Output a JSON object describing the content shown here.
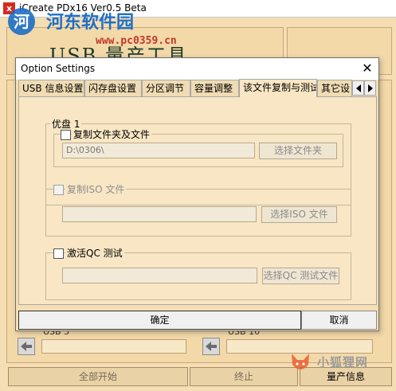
{
  "window": {
    "title": "iCreate PDx16 Ver0.5 Beta",
    "icon_letter": "x"
  },
  "watermark": {
    "logo_char": "河",
    "site_name": "河东软件园",
    "url": "www.pc0359.cn"
  },
  "header": {
    "title": "USB 量产工具"
  },
  "slots": [
    {
      "label": "USB 5"
    },
    {
      "label": "USB 10"
    }
  ],
  "bottom_buttons": {
    "start_all": "全部开始",
    "stop": "终止",
    "production_info": "量产信息"
  },
  "corner_watermark": {
    "text": "小狐狸网"
  },
  "dialog": {
    "title": "Option Settings",
    "close_glyph": "✕",
    "tabs": [
      {
        "label": "USB 信息设置",
        "active": false
      },
      {
        "label": "闪存盘设置",
        "active": false
      },
      {
        "label": "分区调节",
        "active": false
      },
      {
        "label": "容量调整",
        "active": false
      },
      {
        "label": "该文件复制与测试",
        "active": true
      },
      {
        "label": "其它设",
        "active": false
      }
    ],
    "group_disk1": {
      "legend": "优盘 1",
      "copy_folder": {
        "label": "复制文件夹及文件",
        "checked": false,
        "path": "D:\\0306\\",
        "button": "选择文件夹"
      }
    },
    "group_iso": {
      "legend": "复制ISO 文件",
      "checked": false,
      "path": "",
      "button": "选择ISO 文件"
    },
    "group_qc": {
      "legend": "激活QC 测试",
      "checked": false,
      "path": "",
      "button": "选择QC 测试文件"
    },
    "ok_label": "确定",
    "cancel_label": "取消"
  },
  "colors": {
    "background": "#f5deb3",
    "panel": "#f8e6c4",
    "watermark_blue": "#1e6fc8",
    "watermark_red": "#c0392b"
  }
}
